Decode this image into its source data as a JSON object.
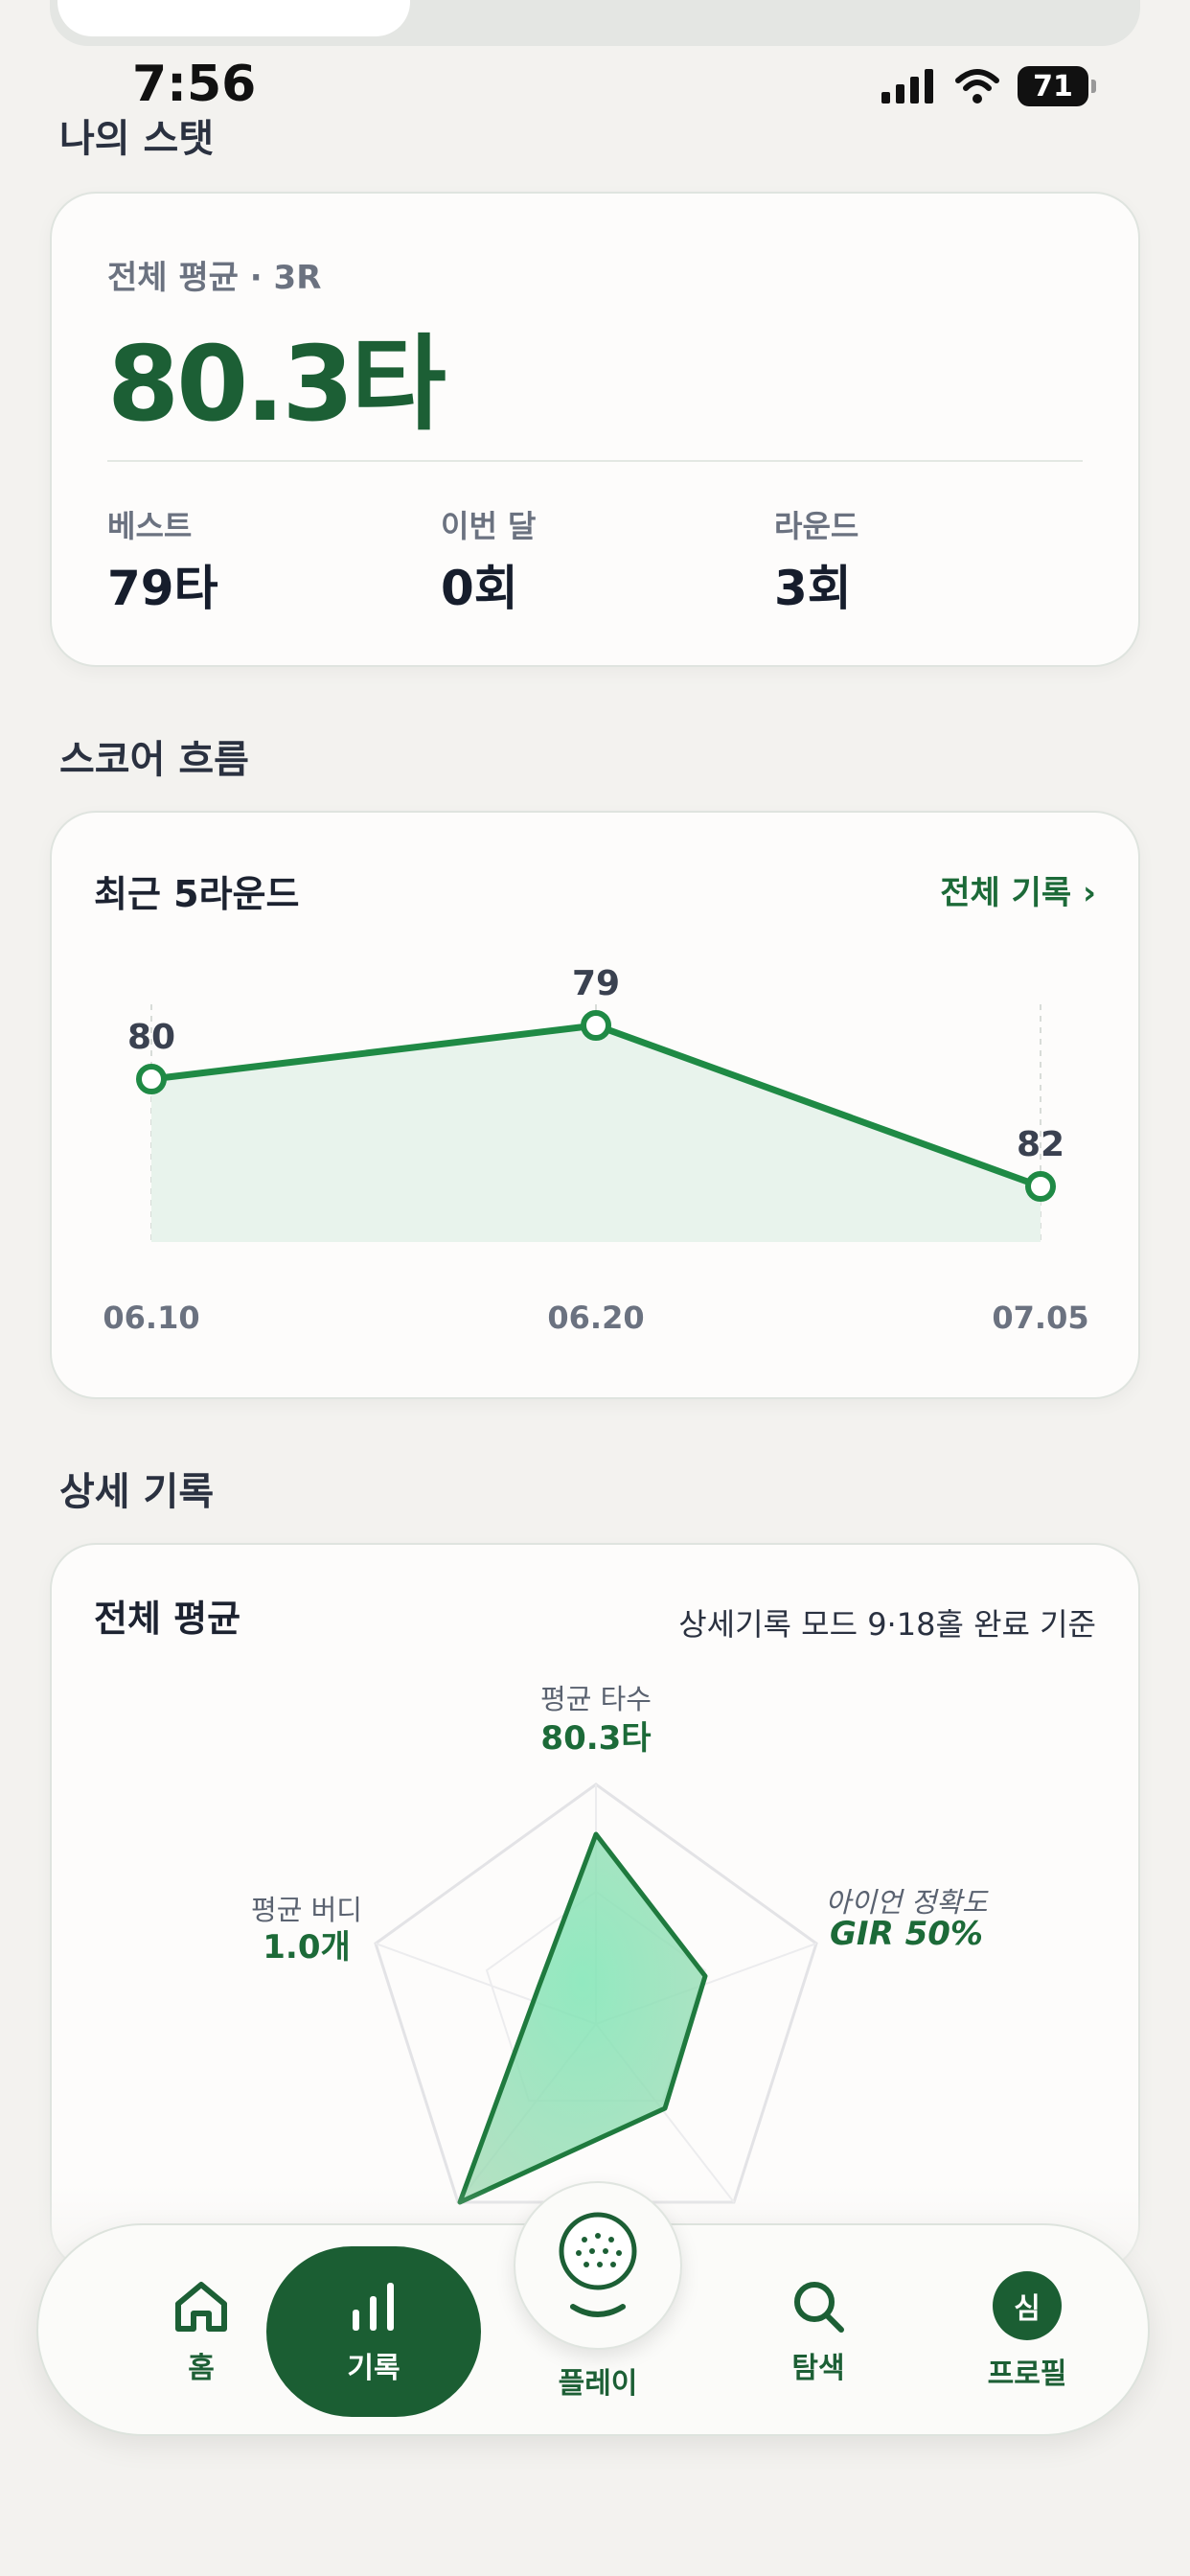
{
  "status_bar": {
    "time": "7:56",
    "battery": "71"
  },
  "stats_section": {
    "title": "나의 스탯",
    "card": {
      "avg_label": "전체 평균 · 3R",
      "avg_value": "80.3타",
      "best_label": "베스트",
      "best_value": "79타",
      "month_label": "이번 달",
      "month_value": "0회",
      "rounds_label": "라운드",
      "rounds_value": "3회"
    }
  },
  "score_section": {
    "title": "스코어 흐름",
    "card_title": "최근 5라운드",
    "link": "전체 기록 ›"
  },
  "chart_data": {
    "type": "area",
    "x": [
      "06.10",
      "06.20",
      "07.05"
    ],
    "values": [
      80,
      79,
      82
    ],
    "data_labels": [
      "80",
      "79",
      "82"
    ],
    "color": "#1f8a45",
    "fill": "#e8f3ec"
  },
  "detail_section": {
    "title": "상세 기록",
    "card_title": "전체 평균",
    "note": "상세기록 모드 9·18홀 완료 기준",
    "radar": {
      "axes": [
        {
          "name": "평균 타수",
          "value": "80.3타",
          "italic": false
        },
        {
          "name": "아이언 정확도",
          "value": "GIR 50%",
          "italic": true
        },
        {
          "name": "평균 버디",
          "value": "1.0개",
          "italic": false
        }
      ]
    }
  },
  "bottom_nav": {
    "items": [
      {
        "label": "홈",
        "icon": "home-icon"
      },
      {
        "label": "기록",
        "icon": "chart-bars-icon",
        "active": true
      },
      {
        "label": "플레이",
        "icon": "golf-ball-icon"
      },
      {
        "label": "탐색",
        "icon": "search-icon"
      },
      {
        "label": "프로필",
        "icon": "avatar",
        "avatar_text": "심"
      }
    ]
  }
}
